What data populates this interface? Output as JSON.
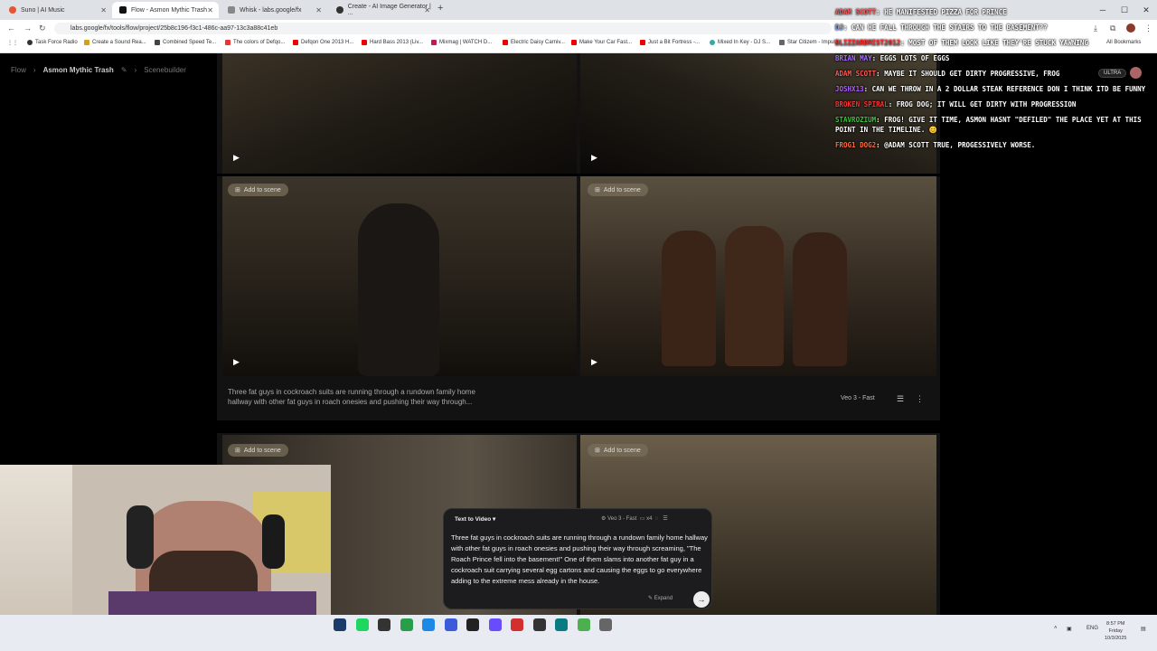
{
  "browser": {
    "tabs": [
      {
        "label": "Suno | AI Music",
        "color": "#e8542f"
      },
      {
        "label": "Flow - Asmon Mythic Trash",
        "color": "#111111"
      },
      {
        "label": "Whisk - labs.google/fx",
        "color": "#888888"
      },
      {
        "label": "Create - AI Image Generator | ...",
        "color": "#333333"
      }
    ],
    "url": "labs.google/fx/tools/flow/project/25b8c196-f3c1-486c-aa97-13c3a88c41eb",
    "bookmarks": [
      "Task Force Radio",
      "Create a Sound Rea...",
      "Combined Speed Te...",
      "The colors of Defqo...",
      "Defqon One 2013 H...",
      "Hard Bass 2013 (Liv...",
      "Mixmag | WATCH D...",
      "Electric Daisy Carniv...",
      "Make Your Car Fast...",
      "Just a Bit Fortress -...",
      "Mixed In Key - DJ S...",
      "Star Citizem - Impul..."
    ],
    "all_bookmarks": "All Bookmarks"
  },
  "app": {
    "breadcrumbs": {
      "root": "Flow",
      "project": "Asmon Mythic Trash",
      "mode": "Scenebuilder"
    },
    "plan_badge": "ULTRA",
    "add_scene_label": "Add to scene",
    "caption": "Three fat guys in cockroach suits are running through a rundown family home hallway with other fat guys in roach onesies and pushing their way through...",
    "model_label": "Veo 3 - Fast"
  },
  "prompt": {
    "mode": "Text to Video",
    "model": "Veo 3 - Fast",
    "count": "x4",
    "text": "Three fat guys in cockroach suits are running through a rundown family home hallway with other fat guys in roach onesies and pushing their way through screaming, \"The Roach Prince fell into the basement!\" One of them slams into another fat guy in a cockroach suit carrying several egg cartons and causing the eggs to go everywhere adding to the extreme mess already in the house.",
    "expand_label": "Expand"
  },
  "chat": [
    {
      "user": "Adam Scott",
      "color": "#ff5a5a",
      "msg": "he manifested pizza for prince"
    },
    {
      "user": "DJ",
      "color": "#7a9cff",
      "msg": "can he fall through the stairs to the basement??"
    },
    {
      "user": "BlizzardMist2012",
      "color": "#ff3030",
      "msg": "Most of them look like they're stuck yawning"
    },
    {
      "user": "Brian May",
      "color": "#a070ff",
      "msg": "eggs lots of eggs"
    },
    {
      "user": "Adam Scott",
      "color": "#ff5a5a",
      "msg": "maybe it should get dirty progressive, Frog"
    },
    {
      "user": "Joshx13",
      "color": "#b060ff",
      "msg": "can we throw in a 2 dollar steak reference don I think itd be funny"
    },
    {
      "user": "Broken Spiral",
      "color": "#ff3030",
      "msg": "Frog dog; it will get dirty with progression"
    },
    {
      "user": "Stavrozium",
      "color": "#40c040",
      "msg": "Frog! give it time, Asmon hasnt \"defiled\" the place yet at this point in the timeline. 😊"
    },
    {
      "user": "Frog1 Dog2",
      "color": "#ff6a3a",
      "msg": "@Adam Scott true, progessively worse."
    }
  ],
  "taskbar": {
    "icon_colors": [
      "#1a3a6a",
      "#1ed760",
      "#333333",
      "#2a9d4a",
      "#1e88e5",
      "#3b5bdb",
      "#222222",
      "#6a4cff",
      "#d32f2f",
      "#333333",
      "#0a7b83",
      "#4caf50",
      "#666666"
    ],
    "lang": "ENG",
    "time": "8:57 PM",
    "day": "Friday",
    "date": "10/3/2025"
  }
}
